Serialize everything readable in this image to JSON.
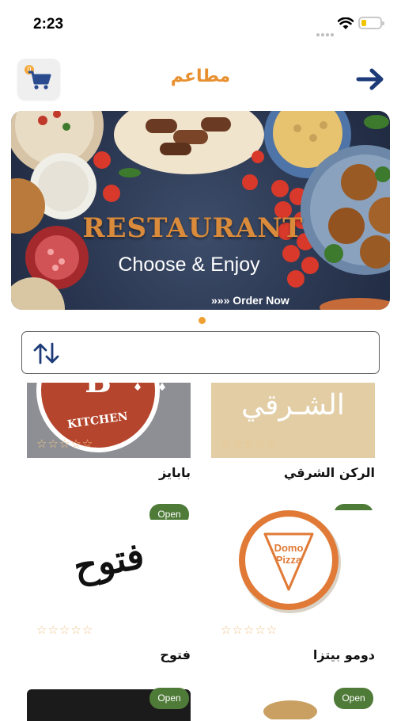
{
  "status_bar": {
    "time": "2:23"
  },
  "header": {
    "title": "مطاعم",
    "cart_icon": "shopping-cart-icon",
    "cart_count": "0",
    "back_icon": "arrow-right-icon",
    "accent_color": "#e8902f"
  },
  "banner": {
    "headline": "RESTAURANT",
    "tagline": "Choose & Enjoy",
    "cta": "»»» Order Now"
  },
  "carousel": {
    "active_index": 0,
    "dot_color": "#f0a030"
  },
  "sort": {
    "icon": "sort-arrows-icon"
  },
  "restaurants": [
    {
      "name": "بابايز",
      "logo_text": "KITCHEN",
      "status": "",
      "rating": 0
    },
    {
      "name": "الركن الشرقي",
      "logo_text": "الشـرقي",
      "status": "",
      "rating": 0
    },
    {
      "name": "فتوح",
      "logo_text": "فتوح",
      "status": "Open",
      "rating": 0
    },
    {
      "name": "دومو بيتزا",
      "logo_text": "Domo Pizza",
      "status": "Open",
      "rating": 0
    },
    {
      "name": "",
      "logo_text": "",
      "status": "Open",
      "rating": 0
    },
    {
      "name": "",
      "logo_text": "",
      "status": "Open",
      "rating": 0
    }
  ],
  "star_symbols": "☆☆☆☆☆",
  "colors": {
    "open_badge": "#4f7b38",
    "star": "#f0c48a"
  }
}
